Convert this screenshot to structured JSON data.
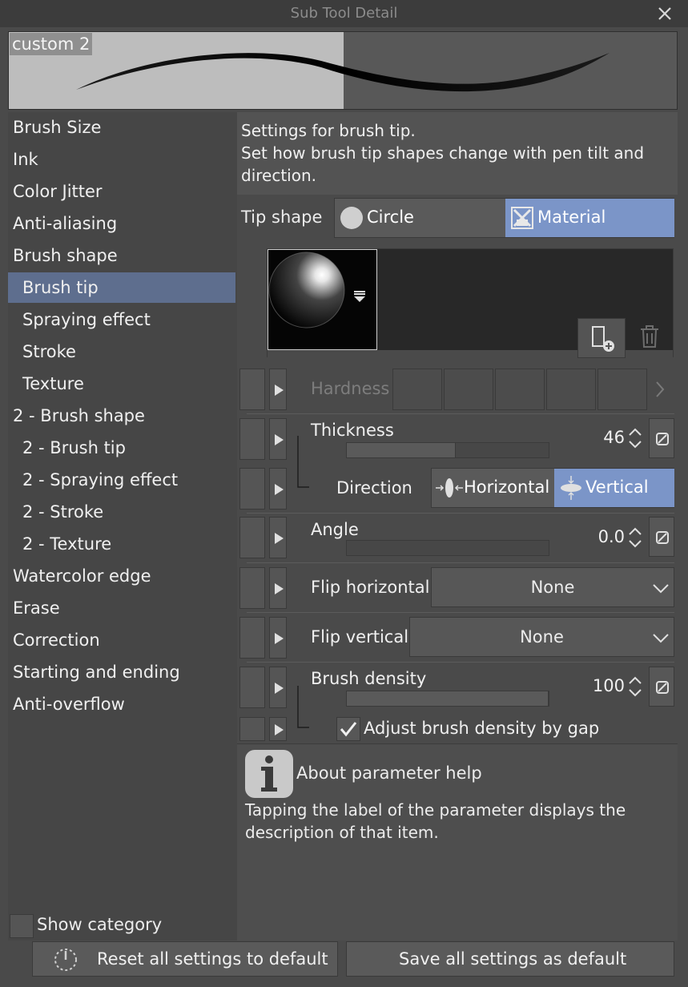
{
  "window": {
    "title": "Sub Tool Detail"
  },
  "preview": {
    "name": "custom 2"
  },
  "categories": [
    {
      "label": "Brush Size"
    },
    {
      "label": "Ink"
    },
    {
      "label": "Color Jitter"
    },
    {
      "label": "Anti-aliasing"
    },
    {
      "label": "Brush shape"
    },
    {
      "label": "Brush tip"
    },
    {
      "label": "Spraying effect"
    },
    {
      "label": "Stroke"
    },
    {
      "label": "Texture"
    },
    {
      "label": "2 - Brush shape"
    },
    {
      "label": "2 - Brush tip"
    },
    {
      "label": "2 - Spraying effect"
    },
    {
      "label": "2 - Stroke"
    },
    {
      "label": "2 - Texture"
    },
    {
      "label": "Watercolor edge"
    },
    {
      "label": "Erase"
    },
    {
      "label": "Correction"
    },
    {
      "label": "Starting and ending"
    },
    {
      "label": "Anti-overflow"
    }
  ],
  "selected_category": "Brush tip",
  "show_category": {
    "label": "Show category",
    "checked": false
  },
  "description": {
    "line1": "Settings for brush tip.",
    "line2": "Set how brush tip shapes change with pen tilt and",
    "line3": "direction."
  },
  "tip_shape": {
    "label": "Tip shape",
    "options": [
      "Circle",
      "Material"
    ],
    "selected": "Material"
  },
  "params": {
    "hardness": {
      "label": "Hardness"
    },
    "thickness": {
      "label": "Thickness",
      "value": "46",
      "fraction": 0.54
    },
    "direction": {
      "label": "Direction",
      "options": [
        "Horizontal",
        "Vertical"
      ],
      "selected": "Vertical"
    },
    "angle": {
      "label": "Angle",
      "value": "0.0",
      "fraction": 0.0
    },
    "flip_horizontal": {
      "label": "Flip horizontal",
      "value": "None"
    },
    "flip_vertical": {
      "label": "Flip vertical",
      "value": "None"
    },
    "brush_density": {
      "label": "Brush density",
      "value": "100",
      "fraction": 1.0
    },
    "adjust_density": {
      "label": "Adjust brush density by gap",
      "checked": true
    }
  },
  "help": {
    "title": "About parameter help",
    "line1": "Tapping the label of the parameter displays the",
    "line2": "description of that item."
  },
  "buttons": {
    "reset_all": "Reset all settings to default",
    "save_all": "Save all settings as default"
  },
  "colors": {
    "accent": "#7b95c8",
    "selection": "#5e6e8e",
    "background": "#4a4a4a"
  }
}
